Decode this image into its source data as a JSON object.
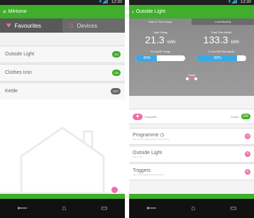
{
  "left": {
    "status_time": "12:30",
    "app_title": "MiHome",
    "tabs": [
      {
        "label": "Favourites",
        "active": true
      },
      {
        "label": "Devices",
        "active": false
      }
    ],
    "devices": [
      {
        "name": "Outside Light",
        "state": "ON"
      },
      {
        "name": "Clothes Iron",
        "state": "ON"
      },
      {
        "name": "Kettle",
        "state": "OFF"
      }
    ]
  },
  "right": {
    "status_time": "12:30",
    "title": "Outside Light",
    "subtabs": [
      "Watt & Percentage",
      "Cost Monthly"
    ],
    "stats": {
      "today_label": "Total Today",
      "today_value": "21.3",
      "month_label": "Total This Month",
      "month_value": "133.3",
      "unit": "kWh",
      "today_pct_label": "% On/Off Today",
      "today_pct": "43%",
      "month_pct_label": "% On/Off This Month",
      "month_pct": "82%"
    },
    "carousel_label": "Costs",
    "controls": {
      "favourite_label": "Favourite",
      "power_label": "Power",
      "power_state": "ON"
    },
    "menu": [
      {
        "title": "Programme",
        "subtitle": "Tap to edit programming for this device"
      },
      {
        "title": "Outside Light",
        "subtitle": "Tap to edit"
      },
      {
        "title": "Triggers",
        "subtitle": "Tap to add triggers for this device"
      }
    ]
  },
  "colors": {
    "brand_green": "#3fae2a",
    "accent_pink": "#f06ea9",
    "progress_blue": "#3aa8e4"
  },
  "progress": {
    "today": 0.43,
    "month": 0.82
  }
}
